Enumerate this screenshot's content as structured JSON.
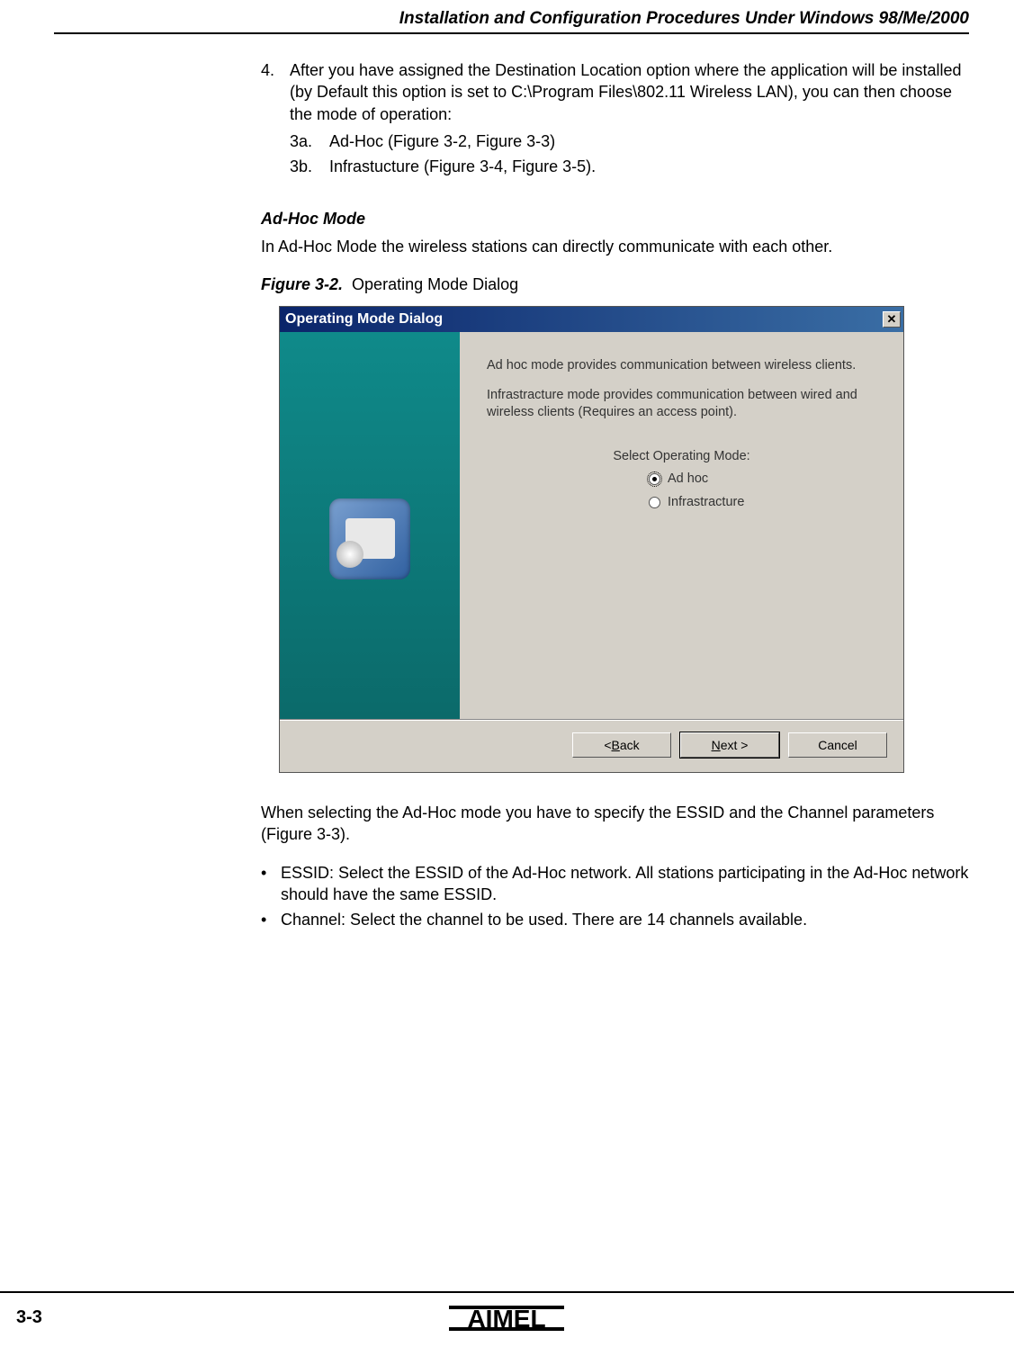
{
  "header": "Installation and Configuration Procedures Under Windows 98/Me/2000",
  "step4": {
    "num": "4.",
    "text": "After you have assigned the Destination Location option where the application will be installed (by Default this option is set to C:\\Program Files\\802.11 Wireless LAN), you can then choose the mode of operation:",
    "sub_a_num": "3a.",
    "sub_a": "Ad-Hoc (Figure 3-2, Figure 3-3)",
    "sub_b_num": "3b.",
    "sub_b": "Infrastucture (Figure 3-4, Figure 3-5)."
  },
  "adhoc_heading": "Ad-Hoc Mode",
  "adhoc_para": "In Ad-Hoc Mode the wireless stations can directly communicate with each other.",
  "figure_label": "Figure 3-2.",
  "figure_title": "Operating Mode Dialog",
  "dialog": {
    "title": "Operating Mode Dialog",
    "desc1": "Ad hoc mode provides communication between wireless clients.",
    "desc2": "Infrastracture mode provides communication between wired and wireless clients (Requires an access point).",
    "select_label": "Select Operating Mode:",
    "radio_adhoc": "Ad hoc",
    "radio_infra": "Infrastracture",
    "btn_back_u": "B",
    "btn_back": "< Back",
    "btn_next_u": "N",
    "btn_next": "Next >",
    "btn_cancel": "Cancel"
  },
  "post_para": "When selecting the Ad-Hoc mode you have to specify the ESSID and the Channel parameters (Figure 3-3).",
  "bullet1": "ESSID: Select the ESSID of the Ad-Hoc network. All stations participating in the Ad-Hoc network should have the same ESSID.",
  "bullet2": "Channel: Select the channel to be used. There are 14 channels available.",
  "page_num": "3-3",
  "logo": "ATMEL"
}
